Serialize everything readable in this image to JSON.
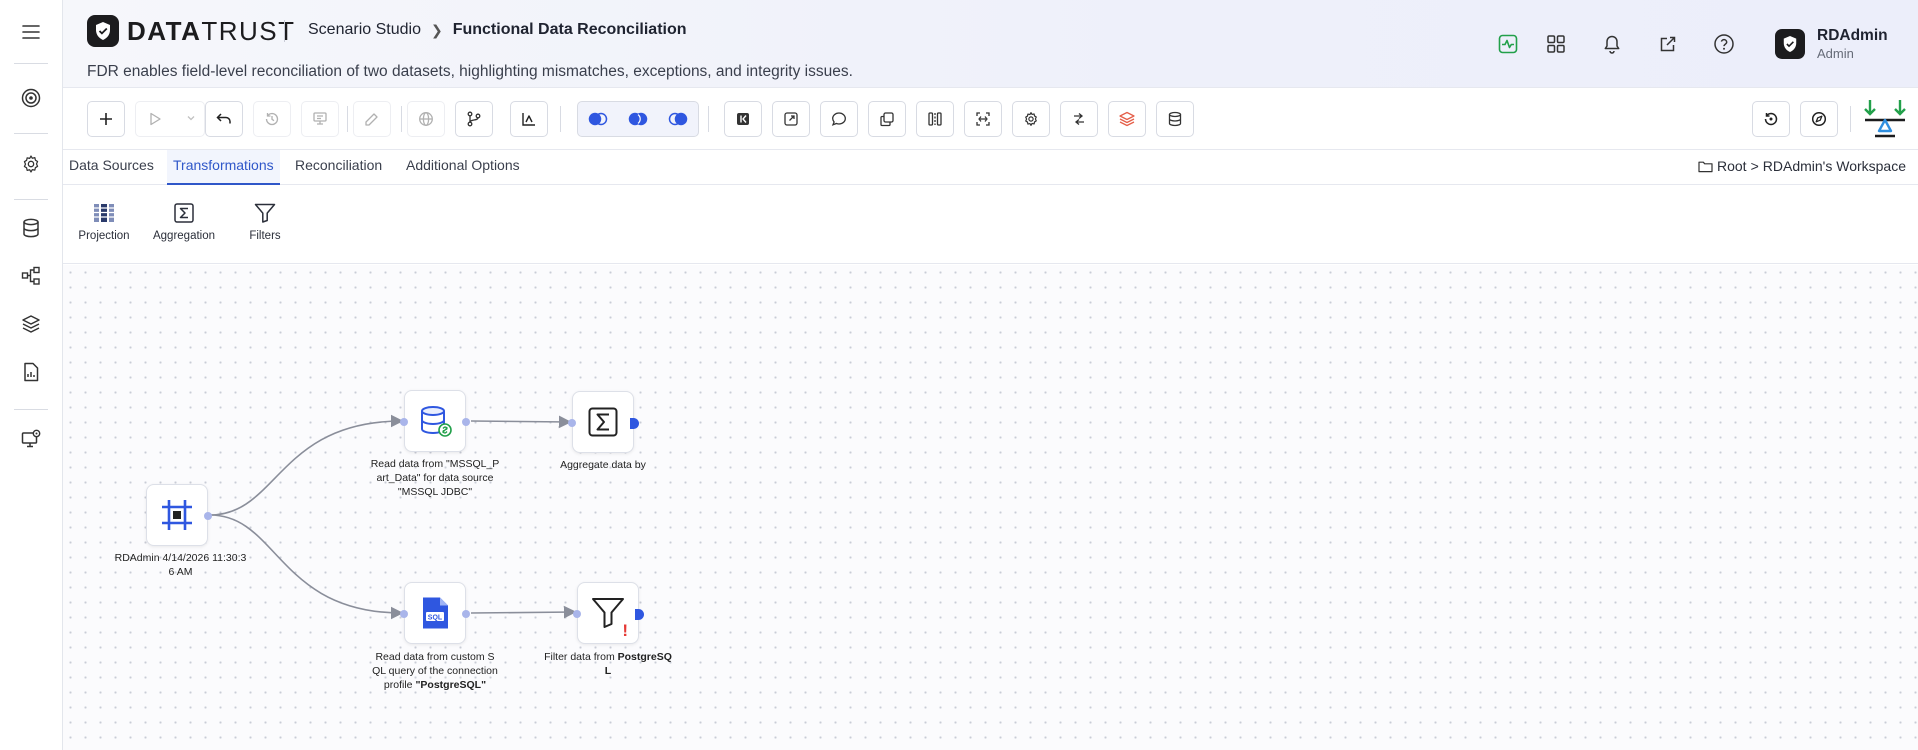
{
  "app": {
    "logo_bold": "DATA",
    "logo_light": "TRUST",
    "breadcrumb_parent": "Scenario Studio",
    "breadcrumb_current": "Functional Data Reconciliation",
    "description": "FDR enables field-level reconciliation of two datasets, highlighting mismatches, exceptions, and integrity issues."
  },
  "user": {
    "name": "RDAdmin",
    "role": "Admin"
  },
  "colors": {
    "accent": "#2f57c9",
    "node_blue": "#2f57e0",
    "warning": "#e53935",
    "dark": "#1c1c1e"
  },
  "tabs": [
    {
      "label": "Data Sources",
      "active": false
    },
    {
      "label": "Transformations",
      "active": true
    },
    {
      "label": "Reconciliation",
      "active": false
    },
    {
      "label": "Additional Options",
      "active": false
    }
  ],
  "workspace": {
    "root": "Root",
    "sep": ">",
    "folder": "RDAdmin's Workspace"
  },
  "palette": [
    {
      "label": "Projection",
      "icon": "projection-icon"
    },
    {
      "label": "Aggregation",
      "icon": "sigma-icon"
    },
    {
      "label": "Filters",
      "icon": "funnel-icon"
    }
  ],
  "nodes": {
    "start": {
      "label": "RDAdmin 4/14/2026 11:30:3 6 AM",
      "icon": "frame-icon"
    },
    "mssql": {
      "label_1": "Read data from \"MSSQL_P",
      "label_2": "art_Data\" for data source",
      "label_3": "\"MSSQL JDBC\"",
      "icon": "database-link-icon"
    },
    "aggregate": {
      "label": "Aggregate data by",
      "icon": "sigma-icon"
    },
    "sql": {
      "label_1": "Read data from custom S",
      "label_2": "QL query of the connection",
      "label_3a": "profile ",
      "label_3b": "\"PostgreSQL\"",
      "icon": "sql-file-icon"
    },
    "filter": {
      "label_a": "Filter data from ",
      "label_b": "PostgreSQ",
      "label_c": "L",
      "icon": "funnel-icon",
      "warning": "!"
    }
  }
}
